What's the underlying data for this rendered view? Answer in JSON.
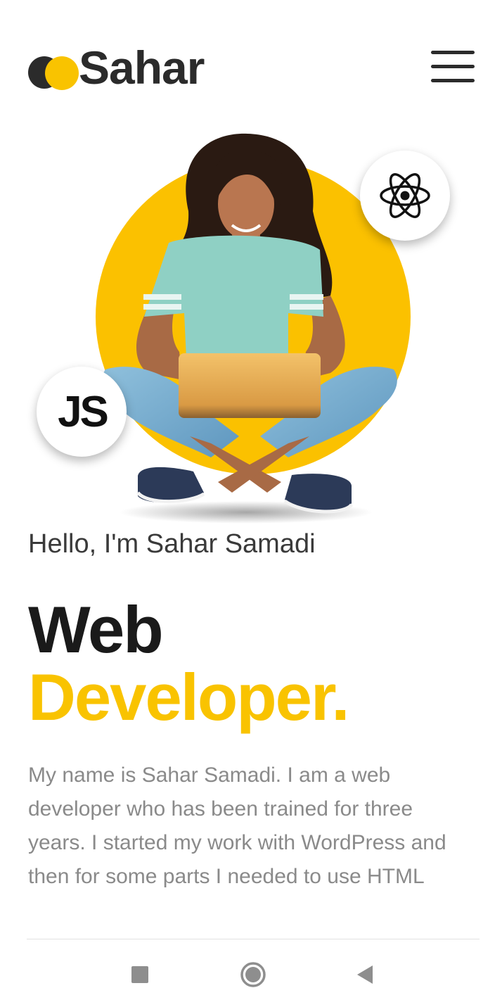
{
  "header": {
    "logo_text": "Sahar",
    "logo_icon": "two-circles-logo-icon",
    "menu_icon": "hamburger-menu-icon"
  },
  "hero": {
    "badges": {
      "react_icon": "react-atom-icon",
      "js_label": "JS"
    }
  },
  "intro": {
    "greeting": "Hello, I'm Sahar Samadi",
    "title_line1": "Web",
    "title_line2": "Developer.",
    "description_lines": [
      "My name is Sahar Samadi. I am a web",
      "developer who has been trained for three",
      "years. I started my work with WordPress and",
      "then for some parts I needed to use HTML"
    ]
  },
  "system_nav": {
    "recent_icon": "square-recents-icon",
    "home_icon": "circle-home-icon",
    "back_icon": "triangle-back-icon"
  },
  "colors": {
    "accent": "#f9c300",
    "text_dark": "#1a1a1a",
    "text_muted": "#8a8a8a"
  }
}
